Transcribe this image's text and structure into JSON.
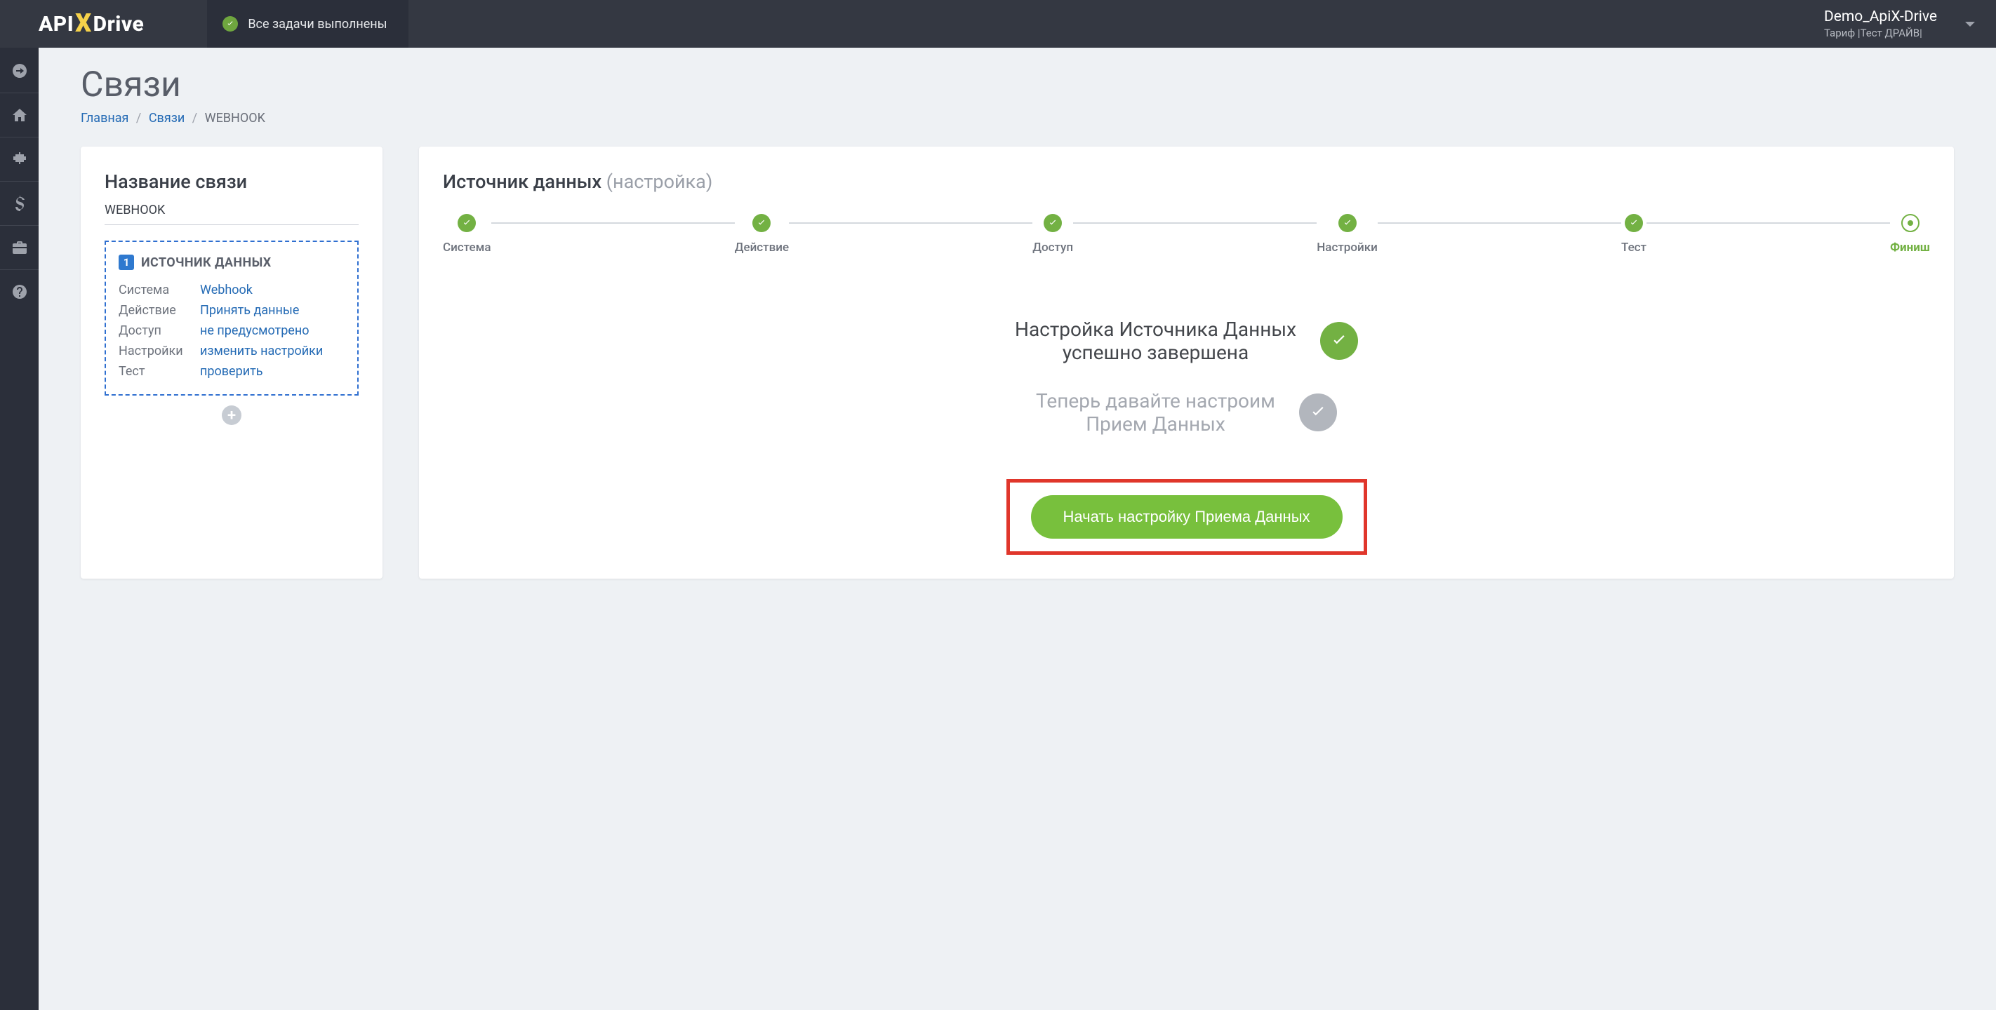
{
  "header": {
    "tasks_label": "Все задачи выполнены",
    "user_name": "Demo_ApiX-Drive",
    "user_plan": "Тариф |Тест ДРАЙВ|"
  },
  "page": {
    "title": "Связи"
  },
  "breadcrumb": {
    "home": "Главная",
    "links": "Связи",
    "current": "WEBHOOK"
  },
  "left_card": {
    "title": "Название связи",
    "connection_name": "WEBHOOK",
    "badge_num": "1",
    "source_title": "ИСТОЧНИК ДАННЫХ",
    "rows": [
      {
        "k": "Система",
        "v": "Webhook"
      },
      {
        "k": "Действие",
        "v": "Принять данные"
      },
      {
        "k": "Доступ",
        "v": "не предусмотрено"
      },
      {
        "k": "Настройки",
        "v": "изменить настройки"
      },
      {
        "k": "Тест",
        "v": "проверить"
      }
    ]
  },
  "right_card": {
    "title": "Источник данных",
    "subtitle": "(настройка)",
    "steps": [
      {
        "label": "Система"
      },
      {
        "label": "Действие"
      },
      {
        "label": "Доступ"
      },
      {
        "label": "Настройки"
      },
      {
        "label": "Тест"
      },
      {
        "label": "Финиш"
      }
    ],
    "success_line1": "Настройка Источника Данных",
    "success_line2": "успешно завершена",
    "next_line1": "Теперь давайте настроим",
    "next_line2": "Прием Данных",
    "start_button": "Начать настройку Приема Данных"
  }
}
